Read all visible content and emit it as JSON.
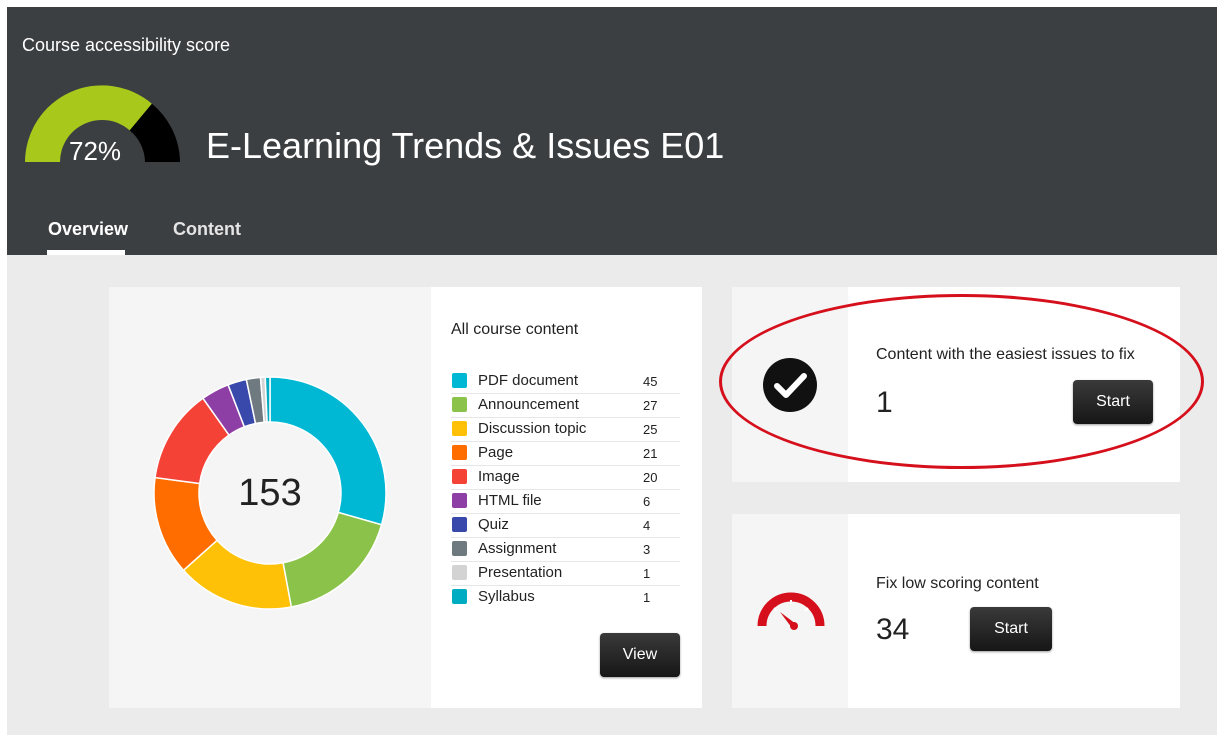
{
  "header": {
    "score_label": "Course accessibility score",
    "score_percent": "72%",
    "score_value": 72,
    "course_title": "E-Learning Trends & Issues E01",
    "tabs": [
      {
        "label": "Overview",
        "active": true
      },
      {
        "label": "Content",
        "active": false
      }
    ],
    "colors": {
      "background": "#3c3f42",
      "gauge_fill": "#a8c91c",
      "gauge_rest": "#000000"
    }
  },
  "content_summary": {
    "title": "All course content",
    "total": "153",
    "view_label": "View",
    "items": [
      {
        "label": "PDF document",
        "count": "45",
        "color": "#00b8d4"
      },
      {
        "label": "Announcement",
        "count": "27",
        "color": "#8bc34a"
      },
      {
        "label": "Discussion topic",
        "count": "25",
        "color": "#ffc107"
      },
      {
        "label": "Page",
        "count": "21",
        "color": "#ff6d00"
      },
      {
        "label": "Image",
        "count": "20",
        "color": "#f44336"
      },
      {
        "label": "HTML file",
        "count": "6",
        "color": "#8e3fa6"
      },
      {
        "label": "Quiz",
        "count": "4",
        "color": "#3949ab"
      },
      {
        "label": "Assignment",
        "count": "3",
        "color": "#6f7a80"
      },
      {
        "label": "Presentation",
        "count": "1",
        "color": "#d3d3d3"
      },
      {
        "label": "Syllabus",
        "count": "1",
        "color": "#00acc1"
      }
    ]
  },
  "chart_data": {
    "type": "pie",
    "categories": [
      "PDF document",
      "Announcement",
      "Discussion topic",
      "Page",
      "Image",
      "HTML file",
      "Quiz",
      "Assignment",
      "Presentation",
      "Syllabus"
    ],
    "values": [
      45,
      27,
      25,
      21,
      20,
      6,
      4,
      3,
      1,
      1
    ],
    "title": "All course content"
  },
  "cards": {
    "easy": {
      "title": "Content with the easiest issues to fix",
      "count": "1",
      "button": "Start",
      "icon": "check-circle-icon"
    },
    "low": {
      "title": "Fix low scoring content",
      "count": "34",
      "button": "Start",
      "icon": "speedometer-icon",
      "icon_color": "#d50f1b"
    }
  }
}
